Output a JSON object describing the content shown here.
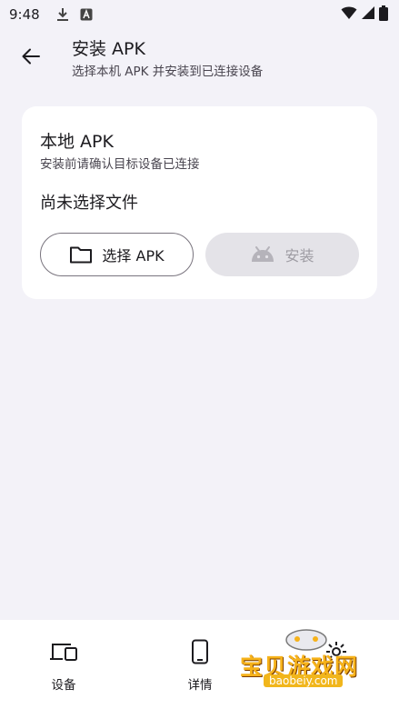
{
  "status_bar": {
    "time": "9:48",
    "icons_left": [
      "download-icon",
      "a-box-icon"
    ],
    "icons_right": [
      "wifi-icon",
      "signal-icon",
      "battery-icon"
    ]
  },
  "app_bar": {
    "title": "安装 APK",
    "subtitle": "选择本机 APK 并安装到已连接设备"
  },
  "card": {
    "title": "本地 APK",
    "hint": "安装前请确认目标设备已连接",
    "file_status": "尚未选择文件",
    "select_button": "选择 APK",
    "install_button": "安装"
  },
  "bottom_nav": {
    "items": [
      {
        "label": "设备",
        "icon": "devices-icon"
      },
      {
        "label": "详情",
        "icon": "phone-icon"
      },
      {
        "label": "",
        "icon": "settings-icon"
      }
    ]
  },
  "watermark": {
    "text": "宝贝游戏网",
    "domain": "baobeiy.com"
  },
  "colors": {
    "background": "#f3f2f8",
    "card": "#ffffff",
    "disabled_button": "#e4e3e8",
    "watermark": "#f6b21a"
  }
}
